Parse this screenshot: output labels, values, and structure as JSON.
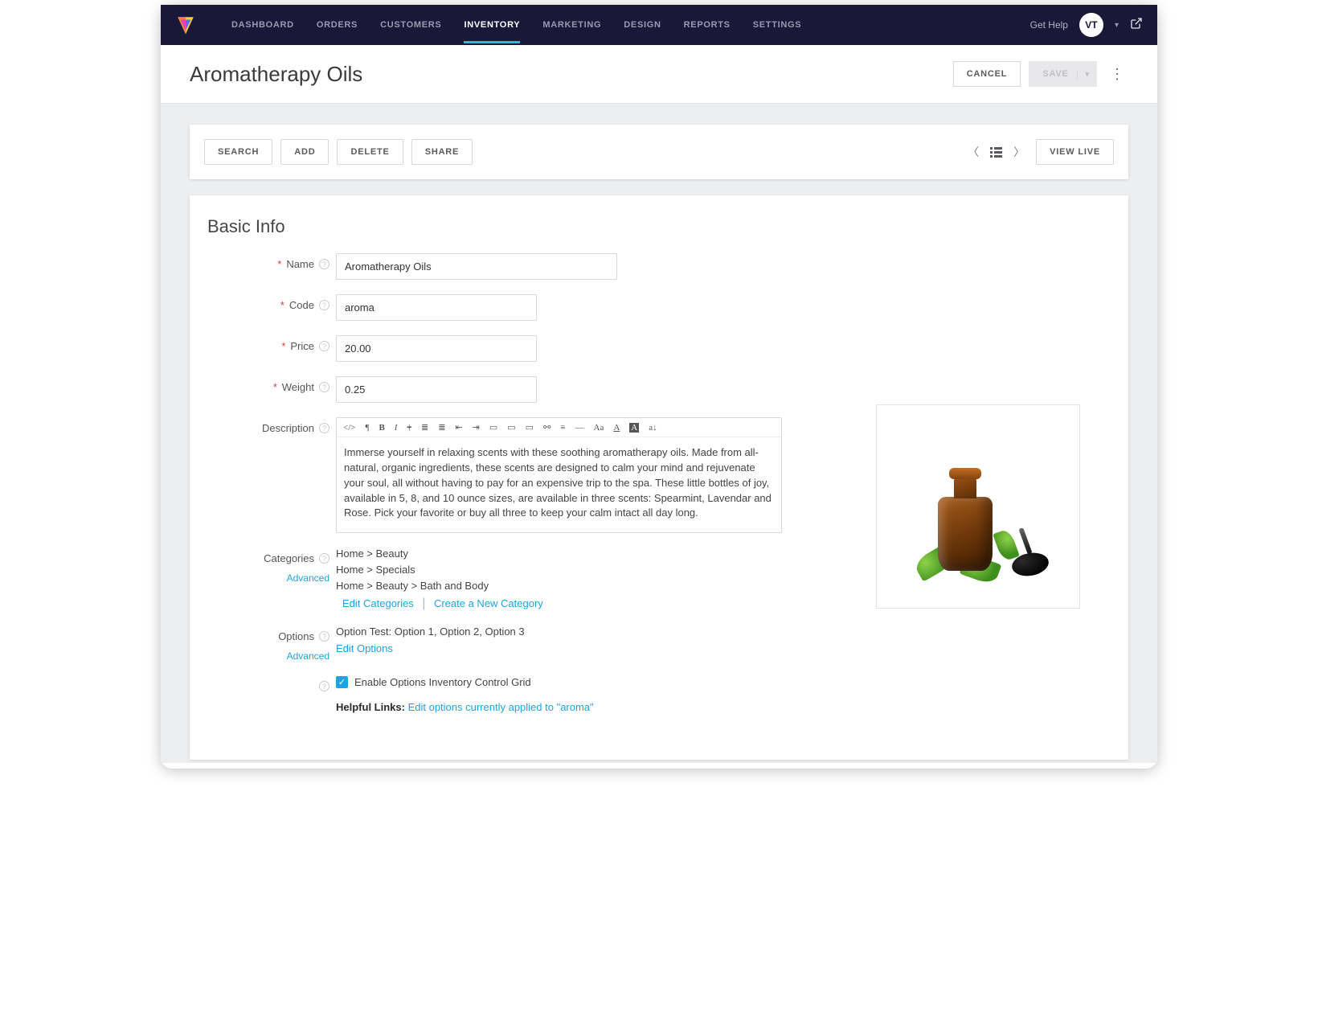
{
  "nav": {
    "items": [
      "DASHBOARD",
      "ORDERS",
      "CUSTOMERS",
      "INVENTORY",
      "MARKETING",
      "DESIGN",
      "REPORTS",
      "SETTINGS"
    ],
    "active_index": 3,
    "get_help": "Get Help",
    "avatar_initials": "VT"
  },
  "header": {
    "title": "Aromatherapy Oils",
    "cancel": "CANCEL",
    "save": "SAVE"
  },
  "toolbar": {
    "search": "SEARCH",
    "add": "ADD",
    "delete": "DELETE",
    "share": "SHARE",
    "view_live": "VIEW LIVE"
  },
  "section_title": "Basic Info",
  "labels": {
    "name": "Name",
    "code": "Code",
    "price": "Price",
    "weight": "Weight",
    "description": "Description",
    "categories": "Categories",
    "options": "Options",
    "advanced": "Advanced"
  },
  "fields": {
    "name": "Aromatherapy Oils",
    "code": "aroma",
    "price": "20.00",
    "weight": "0.25",
    "description": "Immerse yourself in relaxing scents with these soothing aromatherapy oils. Made from all-natural, organic ingredients, these scents are designed to calm your mind and rejuvenate your soul, all without having to pay for an expensive trip to the spa. These little bottles of joy, available in 5, 8, and 10 ounce sizes, are available in three scents: Spearmint, Lavendar and Rose. Pick your favorite or buy all three to keep your calm intact all day long."
  },
  "categories": {
    "paths": [
      "Home > Beauty",
      "Home > Specials",
      "Home > Beauty > Bath and Body"
    ],
    "edit": "Edit Categories",
    "create": "Create a New Category"
  },
  "options": {
    "summary": "Option Test: Option 1, Option 2, Option 3",
    "edit": "Edit Options",
    "checkbox_label": "Enable Options Inventory Control Grid",
    "helpful_prefix": "Helpful Links:",
    "helpful_link": "Edit options currently applied to \"aroma\""
  }
}
